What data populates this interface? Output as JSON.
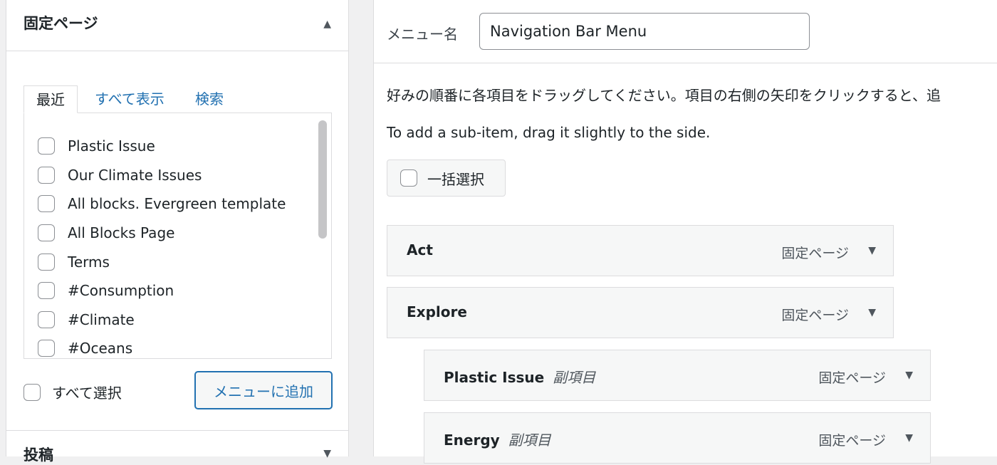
{
  "left": {
    "section_title": "固定ページ",
    "tabs": [
      "最近",
      "すべて表示",
      "検索"
    ],
    "pages": [
      "Plastic Issue",
      "Our Climate Issues",
      "All blocks. Evergreen template",
      "All Blocks Page",
      "Terms",
      "#Consumption",
      "#Climate",
      "#Oceans"
    ],
    "select_all_label": "すべて選択",
    "add_button": "メニューに追加",
    "next_section_title": "投稿"
  },
  "right": {
    "menu_name_label": "メニュー名",
    "menu_name_value": "Navigation Bar Menu",
    "instructions": "好みの順番に各項目をドラッグしてください。項目の右側の矢印をクリックすると、追",
    "subitem_hint": "To add a sub-item, drag it slightly to the side.",
    "bulk_select_label": "一括選択",
    "menu_items": [
      {
        "title": "Act",
        "sub": "",
        "type": "固定ページ"
      },
      {
        "title": "Explore",
        "sub": "",
        "type": "固定ページ"
      },
      {
        "title": "Plastic Issue",
        "sub": "副項目",
        "type": "固定ページ"
      },
      {
        "title": "Energy",
        "sub": "副項目",
        "type": "固定ページ"
      }
    ]
  },
  "icons": {
    "collapse": "triangle-up-icon",
    "expand": "triangle-down-icon"
  },
  "colors": {
    "link": "#2271b1",
    "border": "#dcdcde",
    "background": "#f0f0f1",
    "item_background": "#f6f7f7"
  }
}
